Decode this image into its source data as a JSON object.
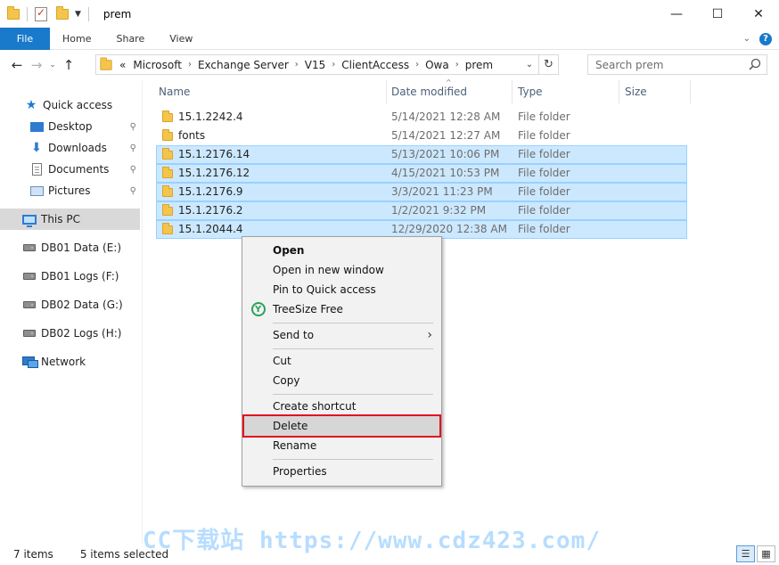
{
  "window": {
    "title": "prem",
    "controls": {
      "minimize": "—",
      "maximize": "☐",
      "close": "✕"
    }
  },
  "ribbon": {
    "tabs": [
      "File",
      "Home",
      "Share",
      "View"
    ],
    "expand_icon": "chevron-down-icon",
    "help_icon": "?"
  },
  "address": {
    "back": "←",
    "forward": "→",
    "recent": "⌄",
    "up": "↑",
    "overflow": "«",
    "crumbs": [
      "Microsoft",
      "Exchange Server",
      "V15",
      "ClientAccess",
      "Owa",
      "prem"
    ],
    "separator": "›",
    "dropdown": "⌄",
    "refresh": "↻"
  },
  "search": {
    "placeholder": "Search prem"
  },
  "nav": {
    "quick_access": "Quick access",
    "items": [
      {
        "label": "Desktop",
        "icon": "desktop-icon",
        "pinned": true
      },
      {
        "label": "Downloads",
        "icon": "download-arrow-icon",
        "pinned": true
      },
      {
        "label": "Documents",
        "icon": "documents-icon",
        "pinned": true
      },
      {
        "label": "Pictures",
        "icon": "pictures-icon",
        "pinned": true
      }
    ],
    "this_pc": "This PC",
    "drives": [
      "DB01 Data (E:)",
      "DB01 Logs (F:)",
      "DB02 Data (G:)",
      "DB02 Logs (H:)"
    ],
    "network": "Network",
    "pin_glyph": "📌"
  },
  "columns": {
    "name": "Name",
    "date": "Date modified",
    "type": "Type",
    "size": "Size",
    "sort_indicator": "^"
  },
  "files": [
    {
      "name": "15.1.2242.4",
      "date": "5/14/2021 12:28 AM",
      "type": "File folder",
      "selected": false
    },
    {
      "name": "fonts",
      "date": "5/14/2021 12:27 AM",
      "type": "File folder",
      "selected": false
    },
    {
      "name": "15.1.2176.14",
      "date": "5/13/2021 10:06 PM",
      "type": "File folder",
      "selected": true
    },
    {
      "name": "15.1.2176.12",
      "date": "4/15/2021 10:53 PM",
      "type": "File folder",
      "selected": true
    },
    {
      "name": "15.1.2176.9",
      "date": "3/3/2021 11:23 PM",
      "type": "File folder",
      "selected": true
    },
    {
      "name": "15.1.2176.2",
      "date": "1/2/2021 9:32 PM",
      "type": "File folder",
      "selected": true
    },
    {
      "name": "15.1.2044.4",
      "date": "12/29/2020 12:38 AM",
      "type": "File folder",
      "selected": true
    }
  ],
  "context_menu": {
    "open": "Open",
    "open_new_window": "Open in new window",
    "pin_quick_access": "Pin to Quick access",
    "treesize": "TreeSize Free",
    "send_to": "Send to",
    "send_to_arrow": "›",
    "cut": "Cut",
    "copy": "Copy",
    "create_shortcut": "Create shortcut",
    "delete": "Delete",
    "rename": "Rename",
    "properties": "Properties",
    "highlight_color": "#e3131f"
  },
  "status": {
    "items": "7 items",
    "selected": "5 items selected"
  },
  "watermark": "CC下载站 https://www.cdz423.com/",
  "colors": {
    "accent": "#1979ca",
    "selection": "#cce8ff",
    "selection_border": "#99d1ff"
  }
}
